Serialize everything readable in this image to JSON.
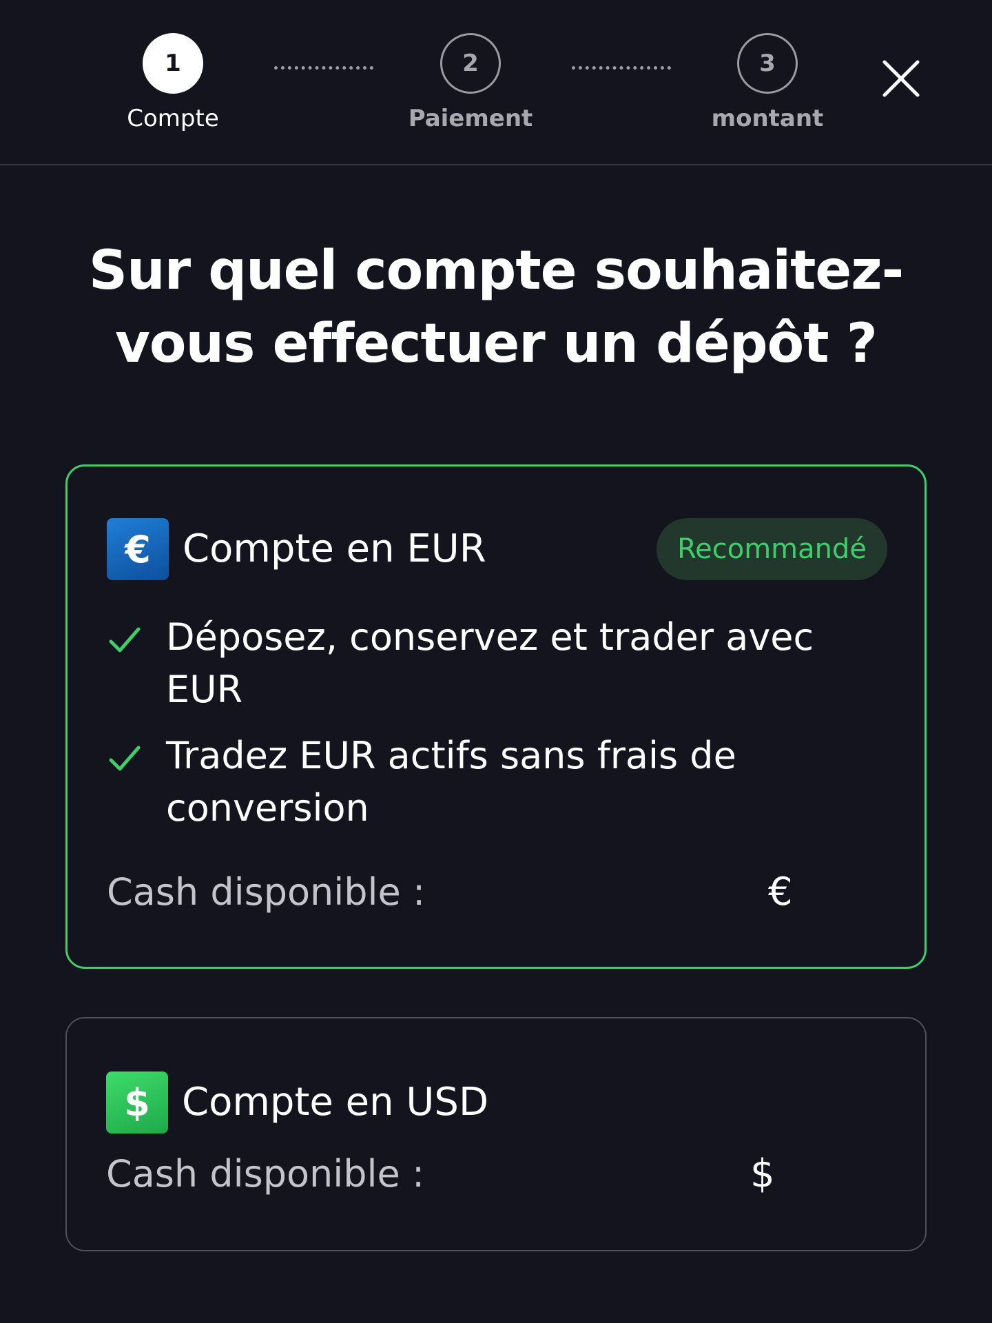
{
  "stepper": {
    "steps": [
      {
        "number": "1",
        "label": "Compte"
      },
      {
        "number": "2",
        "label": "Paiement"
      },
      {
        "number": "3",
        "label": "montant"
      }
    ]
  },
  "header": {
    "close_icon": "close-icon"
  },
  "title": {
    "line1": "Sur quel compte souhaitez-",
    "line2": "vous effectuer un dépôt ?"
  },
  "accounts": {
    "eur": {
      "icon_glyph": "€",
      "title": "Compte en EUR",
      "badge": "Recommandé",
      "features": [
        "Déposez, conservez et trader avec EUR",
        "Tradez EUR actifs sans frais de conversion"
      ],
      "cash_label": "Cash disponible :",
      "cash_symbol": "€"
    },
    "usd": {
      "icon_glyph": "$",
      "title": "Compte en USD",
      "cash_label": "Cash disponible :",
      "cash_symbol": "$"
    }
  },
  "colors": {
    "background": "#13141e",
    "accent_green": "#3fcf6a",
    "badge_bg": "#22382c",
    "eur_blue": "#1565c0",
    "usd_green": "#2ec75a"
  }
}
